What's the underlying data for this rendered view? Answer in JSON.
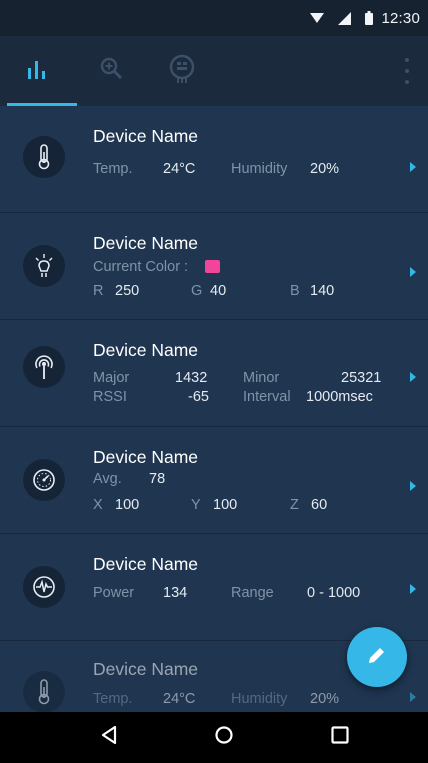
{
  "status_bar": {
    "time": "12:30",
    "icons": [
      "wifi-icon",
      "cell-signal-icon",
      "battery-icon"
    ]
  },
  "app_bar": {
    "tabs": [
      {
        "icon": "bar-chart-icon",
        "active": true
      },
      {
        "icon": "zoom-in-icon",
        "active": false
      },
      {
        "icon": "sensor-tag-icon",
        "active": false
      }
    ],
    "menu_icon": "overflow-menu-icon",
    "accent": "#35b7e8"
  },
  "devices": [
    {
      "icon": "thermometer-icon",
      "name": "Device Name",
      "line1": {
        "a_label": "Temp.",
        "a_value": "24°C",
        "b_label": "Humidity",
        "b_value": "20%"
      }
    },
    {
      "icon": "light-bulb-icon",
      "name": "Device Name",
      "line1": {
        "a_label": "Current Color :",
        "swatch_color": "#f0459a"
      },
      "line2": {
        "r_label": "R",
        "r_value": "250",
        "g_label": "G",
        "g_value": "40",
        "b_label": "B",
        "b_value": "140"
      }
    },
    {
      "icon": "beacon-icon",
      "name": "Device Name",
      "line1": {
        "a_label": "Major",
        "a_value": "1432",
        "b_label": "Minor",
        "b_value": "25321"
      },
      "line2": {
        "a_label": "RSSI",
        "a_value": "-65",
        "b_label": "Interval",
        "b_value": "1000msec"
      }
    },
    {
      "icon": "speedometer-icon",
      "name": "Device Name",
      "line1": {
        "a_label": "Avg.",
        "a_value": "78"
      },
      "line2": {
        "x_label": "X",
        "x_value": "100",
        "y_label": "Y",
        "y_value": "100",
        "z_label": "Z",
        "z_value": "60"
      }
    },
    {
      "icon": "pulse-icon",
      "name": "Device Name",
      "line1": {
        "a_label": "Power",
        "a_value": "134",
        "b_label": "Range",
        "b_value": "0 - 1000"
      }
    },
    {
      "icon": "thermometer-icon",
      "name": "Device Name",
      "line1": {
        "a_label": "Temp.",
        "a_value": "24°C",
        "b_label": "Humidity",
        "b_value": "20%"
      }
    }
  ],
  "fab": {
    "icon": "edit-pencil-icon"
  },
  "nav_bar": {
    "buttons": [
      "back-icon",
      "home-icon",
      "recents-icon"
    ]
  }
}
